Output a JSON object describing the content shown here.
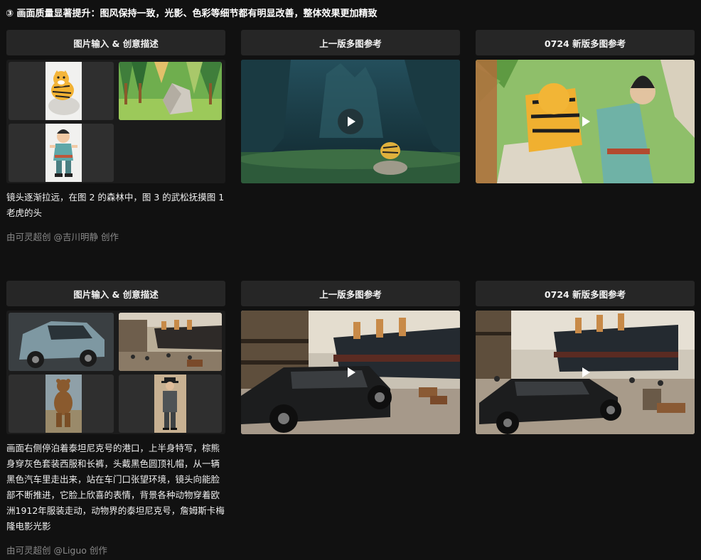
{
  "section_title": "③ 画面质量显著提升：图风保持一致，光影、色彩等细节都有明显改善，整体效果更加精致",
  "examples": [
    {
      "headers": [
        "图片输入 & 创意描述",
        "上一版多图参考",
        "0724 新版多图参考"
      ],
      "description": "镜头逐渐拉远，在图 2 的森林中，图 3 的武松抚摸图 1 老虎的头",
      "credit": "由可灵超创 @吉川明静 创作"
    },
    {
      "headers": [
        "图片输入 & 创意描述",
        "上一版多图参考",
        "0724 新版多图参考"
      ],
      "description": "画面右侧停泊着泰坦尼克号的港口，上半身特写，棕熊身穿灰色套装西服和长裤，头戴黑色圆顶礼帽，从一辆黑色汽车里走出来，站在车门口张望环境，镜头向能脸部不断推进，它脸上欣喜的表情，背景各种动物穿着欧洲1912年服装走动，动物界的泰坦尼克号，詹姆斯卡梅隆电影光影",
      "credit": "由可灵超创 @Liguo 创作"
    }
  ],
  "icons": {
    "play": "play-icon"
  },
  "colors": {
    "background": "#111111",
    "header_bg": "#262626",
    "credit": "#8a8a8a"
  }
}
